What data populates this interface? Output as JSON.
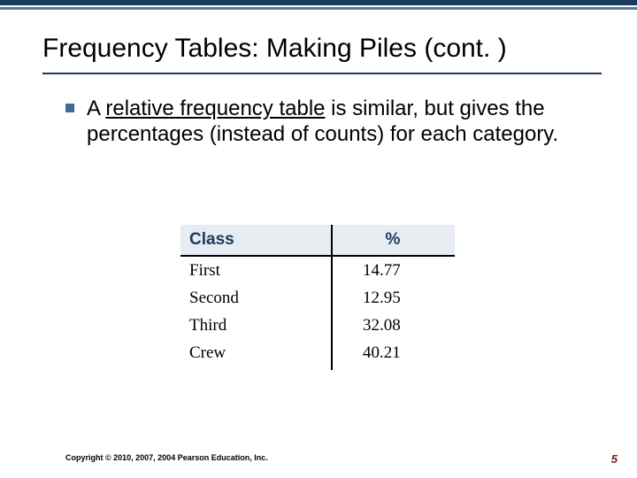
{
  "title": "Frequency Tables: Making Piles (cont. )",
  "bullet": {
    "prefix": "A ",
    "underlined": "relative frequency table",
    "suffix": " is similar, but gives the percentages (instead of counts) for each category."
  },
  "figure": {
    "headers": {
      "class": "Class",
      "pct": "%"
    },
    "rows": [
      {
        "class": "First",
        "pct": "14.77"
      },
      {
        "class": "Second",
        "pct": "12.95"
      },
      {
        "class": "Third",
        "pct": "32.08"
      },
      {
        "class": "Crew",
        "pct": "40.21"
      }
    ]
  },
  "copyright": "Copyright © 2010, 2007, 2004 Pearson Education, Inc.",
  "pagenum": "5",
  "chart_data": {
    "type": "table",
    "title": "Relative frequency table",
    "categories": [
      "First",
      "Second",
      "Third",
      "Crew"
    ],
    "values": [
      14.77,
      12.95,
      32.08,
      40.21
    ],
    "xlabel": "Class",
    "ylabel": "%"
  }
}
